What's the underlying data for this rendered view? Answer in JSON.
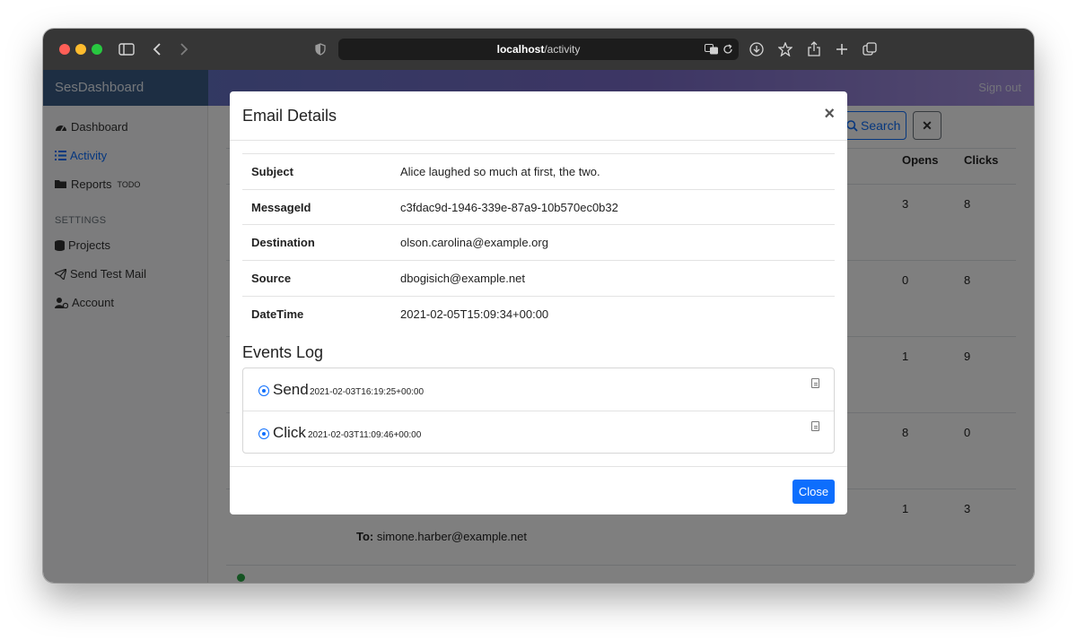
{
  "browser": {
    "url_host": "localhost",
    "url_path": "/activity"
  },
  "app": {
    "brand": "SesDashboard",
    "signout": "Sign out",
    "sidebar": {
      "items": [
        {
          "label": "Dashboard",
          "icon": "dashboard-icon"
        },
        {
          "label": "Activity",
          "icon": "list-icon",
          "active": true
        },
        {
          "label": "Reports",
          "icon": "folder-icon",
          "sup": "TODO"
        }
      ],
      "settings_heading": "SETTINGS",
      "settings_items": [
        {
          "label": "Projects",
          "icon": "database-icon"
        },
        {
          "label": "Send Test Mail",
          "icon": "paper-plane-icon"
        },
        {
          "label": "Account",
          "icon": "user-cog-icon"
        }
      ]
    },
    "main": {
      "search_label": "Search",
      "clear_label": "✕",
      "columns": {
        "opens": "Opens",
        "clicks": "Clicks"
      },
      "rows": [
        {
          "opens": "3",
          "clicks": "8"
        },
        {
          "opens": "0",
          "clicks": "8"
        },
        {
          "opens": "1",
          "clicks": "9"
        },
        {
          "opens": "8",
          "clicks": "0"
        },
        {
          "opens": "1",
          "clicks": "3"
        }
      ],
      "to_label": "To:",
      "to_value": "simone.harber@example.net"
    }
  },
  "modal": {
    "title": "Email Details",
    "close_icon": "×",
    "details": [
      {
        "label": "Subject",
        "value": "Alice laughed so much at first, the two."
      },
      {
        "label": "MessageId",
        "value": "c3fdac9d-1946-339e-87a9-10b570ec0b32"
      },
      {
        "label": "Destination",
        "value": "olson.carolina@example.org"
      },
      {
        "label": "Source",
        "value": "dbogisich@example.net"
      },
      {
        "label": "DateTime",
        "value": "2021-02-05T15:09:34+00:00"
      }
    ],
    "events_title": "Events Log",
    "events": [
      {
        "type": "Send",
        "time": "2021-02-03T16:19:25+00:00"
      },
      {
        "type": "Click",
        "time": "2021-02-03T11:09:46+00:00"
      }
    ],
    "close_button": "Close"
  }
}
